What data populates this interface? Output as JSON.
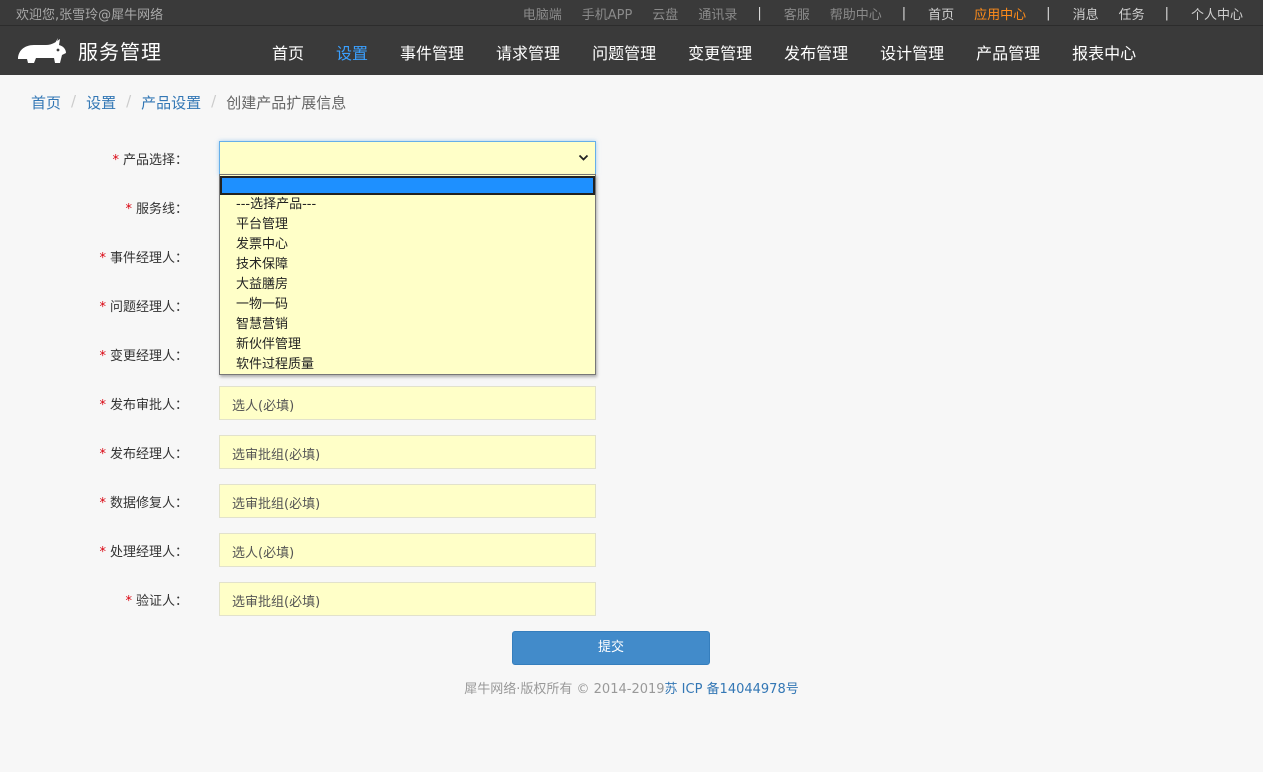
{
  "topbar": {
    "welcome": "欢迎您,张雪玲@犀牛网络",
    "links": [
      {
        "label": "电脑端",
        "style": "dim"
      },
      {
        "label": "手机APP",
        "style": "dim"
      },
      {
        "label": "云盘",
        "style": "dim"
      },
      {
        "label": "通讯录",
        "style": "dim"
      },
      {
        "label": "|",
        "style": "sep"
      },
      {
        "label": "客服",
        "style": "dim"
      },
      {
        "label": "帮助中心",
        "style": "dim"
      },
      {
        "label": "|",
        "style": "sep"
      },
      {
        "label": "首页",
        "style": "lite"
      },
      {
        "label": "应用中心",
        "style": "accent"
      },
      {
        "label": "|",
        "style": "sep"
      },
      {
        "label": "消息",
        "style": "lite"
      },
      {
        "label": "任务",
        "style": "lite"
      },
      {
        "label": "|",
        "style": "sep"
      },
      {
        "label": "个人中心",
        "style": "lite"
      }
    ]
  },
  "nav": {
    "brand_icon": "rhino-logo-icon",
    "brand_title": "服务管理",
    "items": [
      {
        "label": "首页",
        "active": false
      },
      {
        "label": "设置",
        "active": true
      },
      {
        "label": "事件管理",
        "active": false
      },
      {
        "label": "请求管理",
        "active": false
      },
      {
        "label": "问题管理",
        "active": false
      },
      {
        "label": "变更管理",
        "active": false
      },
      {
        "label": "发布管理",
        "active": false
      },
      {
        "label": "设计管理",
        "active": false
      },
      {
        "label": "产品管理",
        "active": false
      },
      {
        "label": "报表中心",
        "active": false
      }
    ]
  },
  "breadcrumb": {
    "items": [
      "首页",
      "设置",
      "产品设置"
    ],
    "current": "创建产品扩展信息"
  },
  "form": {
    "product_select": {
      "label": "产品选择：",
      "value": ""
    },
    "dropdown_options": [
      "",
      "---选择产品---",
      "平台管理",
      "发票中心",
      "技术保障",
      "大益膳房",
      "一物一码",
      "智慧营销",
      "新伙伴管理",
      "软件过程质量"
    ],
    "fields": [
      {
        "label": "服务线：",
        "placeholder": ""
      },
      {
        "label": "事件经理人：",
        "placeholder": ""
      },
      {
        "label": "问题经理人：",
        "placeholder": ""
      },
      {
        "label": "变更经理人：",
        "placeholder": ""
      },
      {
        "label": "发布审批人：",
        "placeholder": "选人(必填)"
      },
      {
        "label": "发布经理人：",
        "placeholder": "选审批组(必填)"
      },
      {
        "label": "数据修复人：",
        "placeholder": "选审批组(必填)"
      },
      {
        "label": "处理经理人：",
        "placeholder": "选人(必填)"
      },
      {
        "label": "验证人：",
        "placeholder": "选审批组(必填)"
      }
    ],
    "required_mark": "*",
    "submit_label": "提交"
  },
  "footer": {
    "copyright": "犀牛网络·版权所有 © 2014-2019",
    "icp": "苏 ICP 备14044978号"
  },
  "colors": {
    "topbar_bg": "#3a3a3a",
    "active_nav": "#3aa0ff",
    "accent": "#ff8c1a",
    "field_bg": "#ffffc8",
    "primary_button": "#428bca",
    "link": "#3377b5"
  }
}
